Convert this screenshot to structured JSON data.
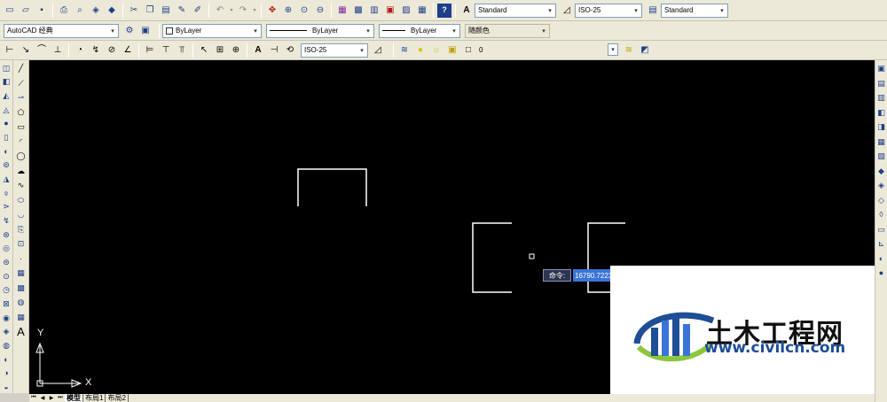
{
  "toolbar_top": {
    "text_style": "Standard",
    "dim_style": "ISO-25",
    "table_style": "Standard"
  },
  "workspace": "AutoCAD 经典",
  "properties": {
    "color": "ByLayer",
    "linetype": "ByLayer",
    "lineweight": "ByLayer",
    "plot_style": "随颜色"
  },
  "dim_toolbar": {
    "dim_style": "ISO-25"
  },
  "layer": {
    "current": "0"
  },
  "command": {
    "label": "命令:",
    "input_value": "16790.7223"
  },
  "ucs": {
    "x_label": "X",
    "y_label": "Y"
  },
  "tabs": [
    "模型",
    "布局1",
    "布局2"
  ],
  "watermark": {
    "name": "土木工程网",
    "url": "www.civilcn.com"
  },
  "colors": {
    "canvas": "#000000",
    "geometry": "#ffffff",
    "input_highlight": "#3a74d8",
    "watermark_blue": "#1d4e96"
  }
}
